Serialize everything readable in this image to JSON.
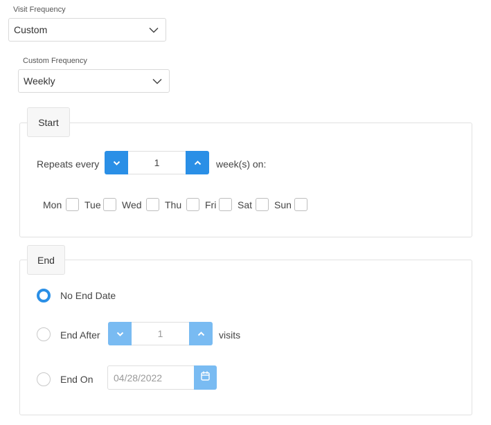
{
  "visit_frequency": {
    "label": "Visit Frequency",
    "value": "Custom"
  },
  "custom_frequency": {
    "label": "Custom Frequency",
    "value": "Weekly"
  },
  "start": {
    "legend": "Start",
    "repeats_label": "Repeats every",
    "interval_value": "1",
    "unit_label": "week(s) on:",
    "days": [
      {
        "label": "Mon",
        "checked": false
      },
      {
        "label": "Tue",
        "checked": false
      },
      {
        "label": "Wed",
        "checked": false
      },
      {
        "label": "Thu",
        "checked": false
      },
      {
        "label": "Fri",
        "checked": false
      },
      {
        "label": "Sat",
        "checked": false
      },
      {
        "label": "Sun",
        "checked": false
      }
    ]
  },
  "end": {
    "legend": "End",
    "options": [
      {
        "label": "No End Date",
        "selected": true
      },
      {
        "label": "End After",
        "selected": false
      },
      {
        "label": "End On",
        "selected": false
      }
    ],
    "end_after_value": "1",
    "end_after_unit": "visits",
    "end_on_date": "04/28/2022"
  },
  "icons": {
    "dropdown": "chevron-down-icon",
    "decrement": "chevron-down-icon",
    "increment": "chevron-up-icon",
    "calendar": "calendar-icon"
  },
  "colors": {
    "accent": "#2a8fe6",
    "accent_disabled": "#79bbf2",
    "border": "#e1e1e1"
  }
}
